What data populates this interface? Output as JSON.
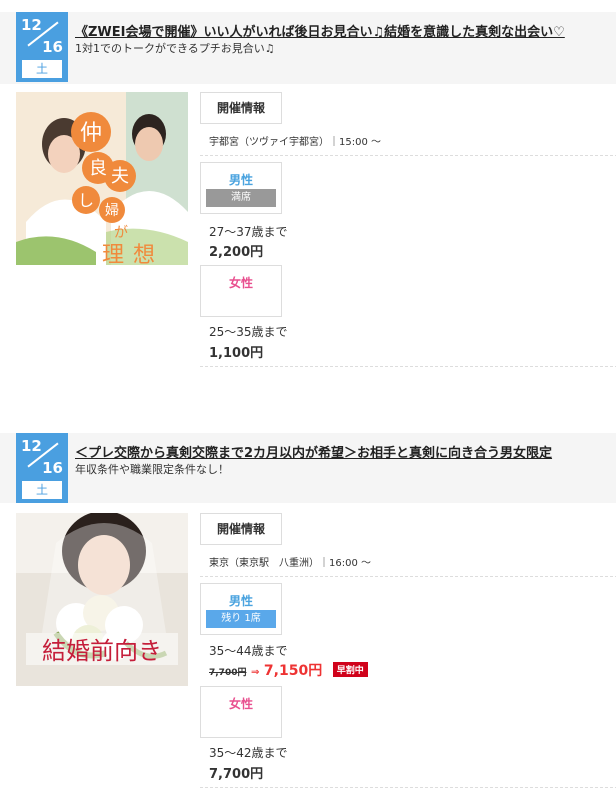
{
  "events": [
    {
      "date": {
        "month": "12",
        "day": "16",
        "weekday": "土"
      },
      "title": "《ZWEI会場で開催》いい人がいれば後日お見合い♫結婚を意識した真剣な出会い♡",
      "subtitle": "1対1でのトークができるプチお見合い♫",
      "photo_caption": {
        "c1": "仲",
        "c2": "良",
        "c3": "し",
        "c4": "夫",
        "c5": "婦",
        "c6": "が",
        "c7": "理",
        "c8": "想"
      },
      "info_label": "開催情報",
      "venue": "宇都宮（ツヴァイ宇都宮）｜15:00 ～",
      "male": {
        "label": "男性",
        "badge": "満席",
        "age": "27～37歳まで",
        "price": "2,200円"
      },
      "female": {
        "label": "女性",
        "age": "25～35歳まで",
        "price": "1,100円"
      }
    },
    {
      "date": {
        "month": "12",
        "day": "16",
        "weekday": "土"
      },
      "title": "＜プレ交際から真剣交際まで2カ月以内が希望＞お相手と真剣に向き合う男女限定",
      "subtitle": "年収条件や職業限定条件なし！",
      "photo_caption": "結婚前向き",
      "info_label": "開催情報",
      "venue": "東京（東京駅　八重洲）｜16:00 ～",
      "male": {
        "label": "男性",
        "badge": "残り 1席",
        "age": "35～44歳まで",
        "price_old": "7,700円",
        "price_arrow": "⇒",
        "price_new": "7,150円",
        "early_label": "早割中"
      },
      "female": {
        "label": "女性",
        "age": "35～42歳まで",
        "price": "7,700円"
      }
    }
  ],
  "colors": {
    "date_blue": "#4a9fe0",
    "male_blue": "#4aa3df",
    "female_pink": "#e8508f",
    "sale_red": "#e33333",
    "early_badge": "#d0021b"
  }
}
